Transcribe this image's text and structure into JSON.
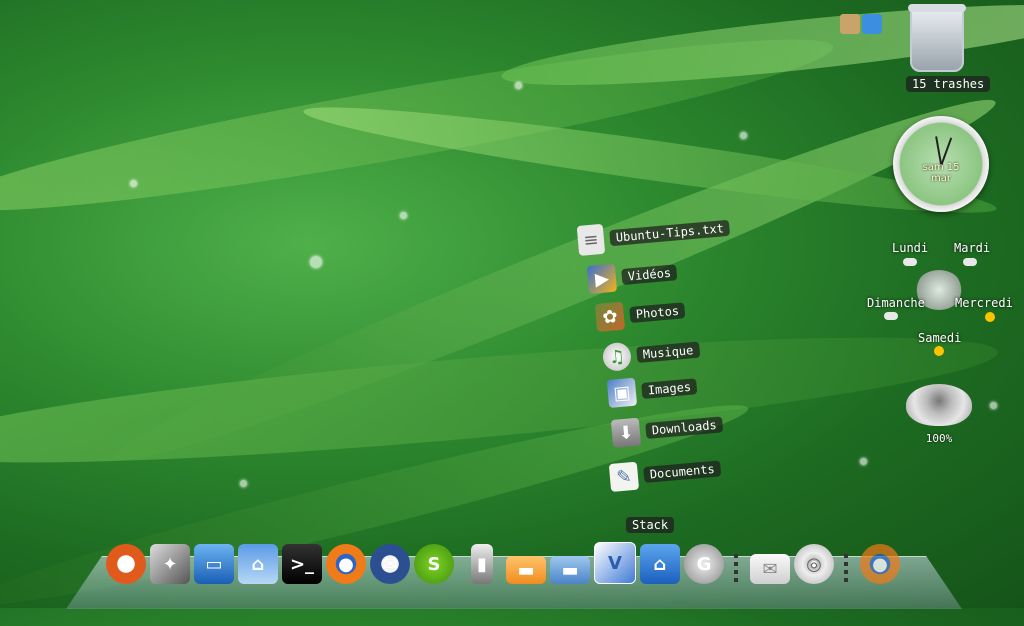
{
  "stack_menu": {
    "title": "Stack",
    "items": [
      {
        "label": "Ubuntu-Tips.txt",
        "icon": "text-file-icon"
      },
      {
        "label": "Vidéos",
        "icon": "video-folder-icon"
      },
      {
        "label": "Photos",
        "icon": "photos-folder-icon"
      },
      {
        "label": "Musique",
        "icon": "music-folder-icon"
      },
      {
        "label": "Images",
        "icon": "images-folder-icon"
      },
      {
        "label": "Downloads",
        "icon": "downloads-folder-icon"
      },
      {
        "label": "Documents",
        "icon": "documents-folder-icon"
      }
    ]
  },
  "trash": {
    "label": "15 trashes"
  },
  "clock": {
    "date": "sam 15 mar"
  },
  "weather": {
    "days": [
      "Lundi",
      "Mardi",
      "Dimanche",
      "Mercredi",
      "Samedi"
    ]
  },
  "volume": {
    "level": "100%"
  },
  "dock": {
    "items": [
      "ubuntu-icon",
      "media-icon",
      "display-icon",
      "home-icon",
      "terminal-icon",
      "firefox-icon",
      "thunderbird-icon",
      "skype-icon",
      "phone-icon",
      "folder-icon",
      "folder-icon",
      "vlc-icon",
      "stack-icon",
      "gimp-icon",
      "mail-icon",
      "cd-icon",
      "firefox-icon"
    ]
  },
  "colors": {
    "accent": "#2e8a2f",
    "label_bg": "#1e1e1e"
  }
}
